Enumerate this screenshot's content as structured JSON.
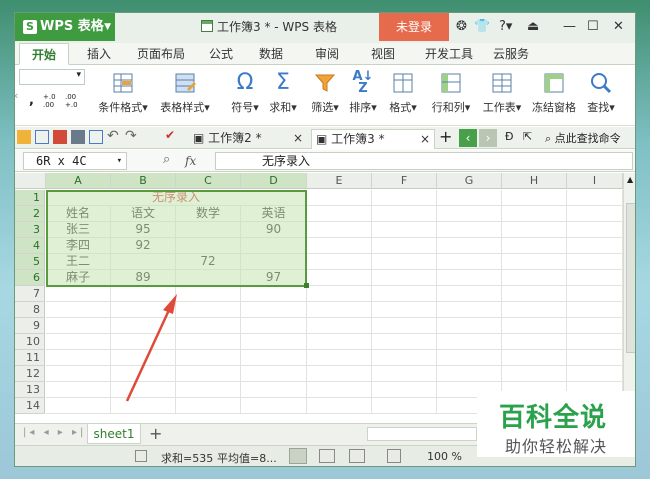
{
  "app": {
    "logo_text": "WPS 表格",
    "window_title": "工作簿3 * - WPS 表格",
    "login_button": "未登录",
    "help_label": "?",
    "colors": {
      "brand_green": "#3f9b3f",
      "login_red": "#e66b4d",
      "selection_green": "#5a9a3f",
      "title_text_red": "#cc2b2b"
    }
  },
  "ribbon": {
    "tabs": [
      "开始",
      "插入",
      "页面布局",
      "公式",
      "数据",
      "审阅",
      "视图",
      "开发工具",
      "云服务"
    ],
    "active_tab": "开始",
    "number_format_samples": [
      ",",
      "+.0 .00",
      ".00 +.0"
    ],
    "buttons": [
      "条件格式",
      "表格样式",
      "符号",
      "求和",
      "筛选",
      "排序",
      "格式",
      "行和列",
      "工作表",
      "冻结窗格",
      "查找"
    ]
  },
  "doc_tabs": {
    "tabs": [
      "工作簿2 *",
      "工作簿3 *"
    ],
    "active": "工作簿3 *",
    "search_label": "点此查找命令"
  },
  "formula_bar": {
    "name_box": "6R x 4C",
    "fx_label": "fx",
    "content": "无序录入"
  },
  "grid": {
    "columns": [
      "A",
      "B",
      "C",
      "D",
      "E",
      "F",
      "G",
      "H",
      "I"
    ],
    "rows": [
      "1",
      "2",
      "3",
      "4",
      "5",
      "6",
      "7",
      "8",
      "9",
      "10",
      "11",
      "12",
      "13",
      "14"
    ],
    "title": "无序录入",
    "headers": [
      "姓名",
      "语文",
      "数学",
      "英语"
    ],
    "data": [
      [
        "张三",
        "95",
        "",
        "90"
      ],
      [
        "李四",
        "92",
        "",
        ""
      ],
      [
        "王二",
        "",
        "72",
        ""
      ],
      [
        "麻子",
        "89",
        "",
        "97"
      ]
    ]
  },
  "sheets": {
    "tabs": [
      "sheet1"
    ],
    "add_label": "+"
  },
  "status_bar": {
    "sum": "求和=535",
    "average": "平均值=8...",
    "zoom": "100 %"
  },
  "watermark": {
    "line1": "百科全说",
    "line2": "助你轻松解决"
  }
}
